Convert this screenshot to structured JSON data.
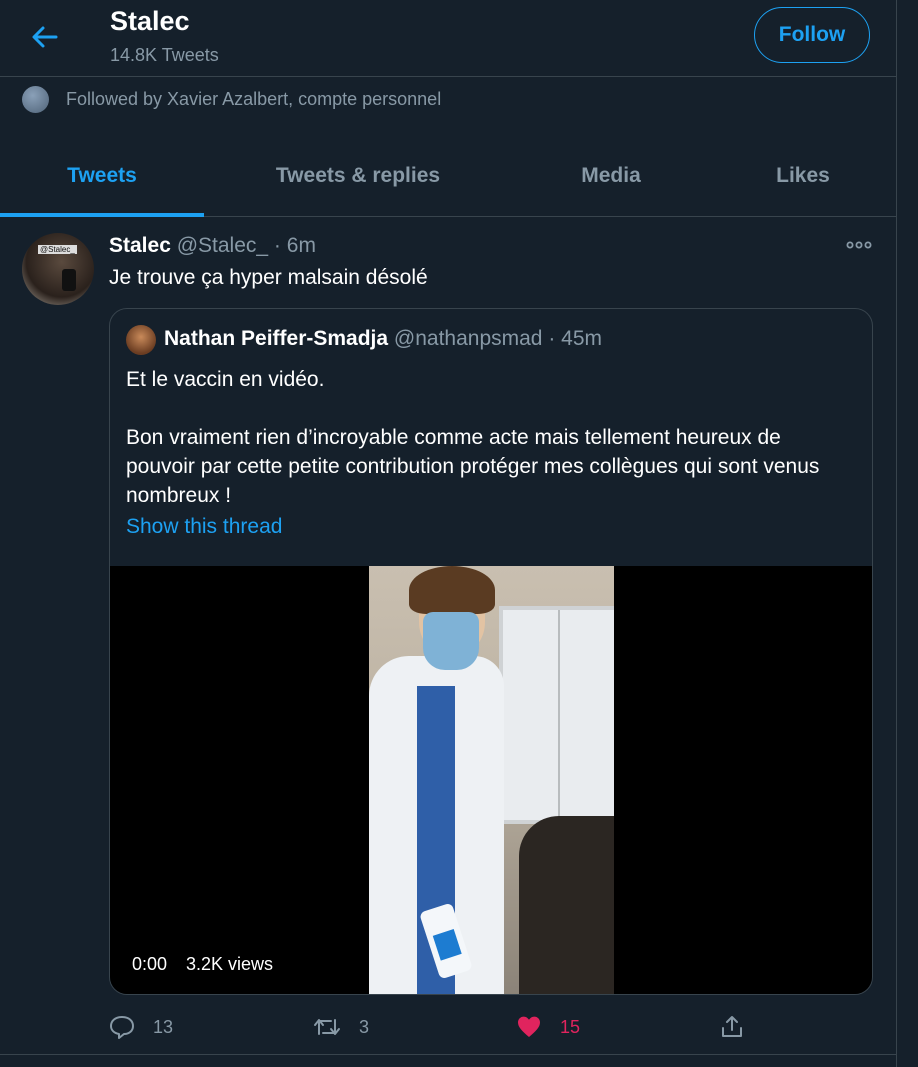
{
  "header": {
    "name": "Stalec",
    "tweet_count": "14.8K Tweets",
    "follow_label": "Follow",
    "followed_by": "Followed by Xavier Azalbert, compte personnel"
  },
  "tabs": [
    {
      "label": "Tweets",
      "active": true
    },
    {
      "label": "Tweets & replies",
      "active": false
    },
    {
      "label": "Media",
      "active": false
    },
    {
      "label": "Likes",
      "active": false
    }
  ],
  "tweet": {
    "avatar_tag": "@Stalec_",
    "name": "Stalec",
    "handle": "@Stalec_",
    "separator": " · ",
    "time": "6m",
    "text": "Je trouve ça hyper malsain désolé",
    "quote": {
      "name": "Nathan Peiffer-Smadja",
      "handle": "@nathanpsmad",
      "separator": " · ",
      "time": "45m",
      "line1": "Et le vaccin en vidéo.",
      "line2": "Bon vraiment rien d’incroyable comme acte mais tellement heureux de pouvoir par cette petite contribution protéger mes collègues qui sont venus nombreux !",
      "show_thread": "Show this thread",
      "video_time": "0:00",
      "video_views": "3.2K views"
    },
    "actions": {
      "replies": "13",
      "retweets": "3",
      "likes": "15",
      "liked": true
    }
  },
  "colors": {
    "background": "#15202b",
    "accent": "#1da1f2",
    "muted": "#8899a6",
    "border": "#38444d",
    "like": "#e0245e"
  },
  "icons": [
    "back-arrow-icon",
    "more-icon",
    "reply-icon",
    "retweet-icon",
    "heart-icon",
    "share-icon"
  ]
}
